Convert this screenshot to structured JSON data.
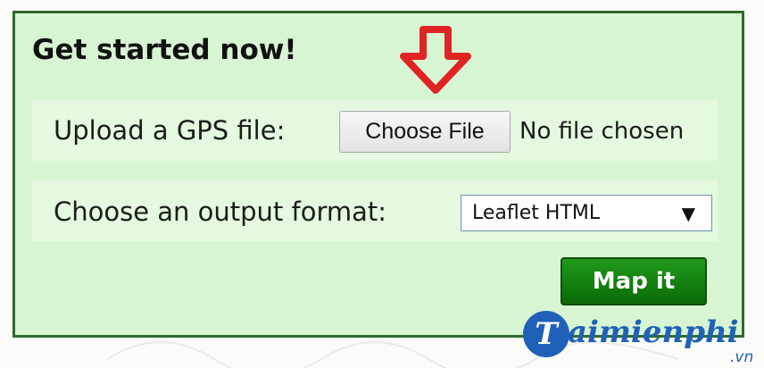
{
  "panel": {
    "title": "Get started now!"
  },
  "upload": {
    "label": "Upload a GPS file:",
    "button_label": "Choose File",
    "status_text": "No file chosen"
  },
  "output_format": {
    "label": "Choose an output format:",
    "selected_value": "Leaflet HTML",
    "caret_glyph": "▼"
  },
  "actions": {
    "map_button_label": "Map it"
  },
  "watermark": {
    "logo_letter": "T",
    "brand_name": "aimienphi",
    "tld": ".vn"
  },
  "annotation": {
    "arrow_color": "#e02424"
  },
  "colors": {
    "panel_border": "#2f6b2a",
    "panel_background": "#d8f5d3",
    "map_button": "#0b6a08",
    "brand_blue": "#1f61b8"
  },
  "icons": [
    "down-arrow-annotation-icon",
    "dropdown-caret-icon",
    "brand-logo-icon"
  ]
}
